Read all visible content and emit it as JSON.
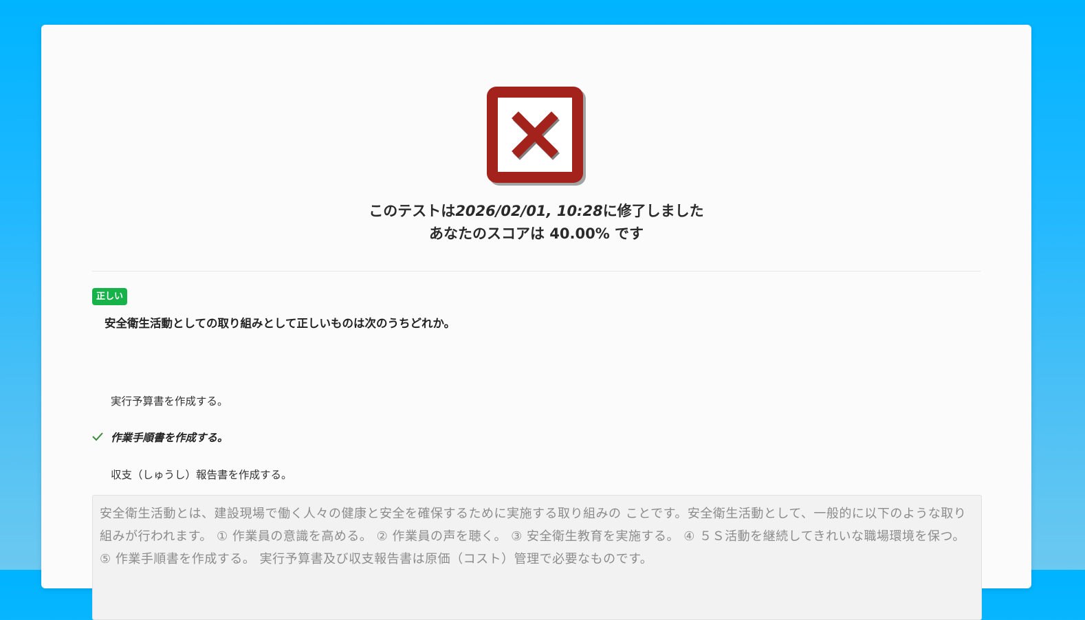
{
  "result": {
    "icon": "red-x-icon",
    "accent_color": "#a3221c",
    "line1_prefix": "このテストは",
    "line1_datetime": "2026/02/01, 10:28",
    "line1_suffix": "に修了しました",
    "line2_prefix": "あなたのスコアは ",
    "score": "40.00%",
    "line2_suffix": " です"
  },
  "question": {
    "badge": "正しい",
    "badge_color": "#18b24b",
    "text": "安全衛生活動としての取り組みとして正しいものは次のうちどれか。",
    "options": [
      {
        "label": "実行予算書を作成する。",
        "selected": false
      },
      {
        "label": "作業手順書を作成する。",
        "selected": true,
        "icon": "check-icon"
      },
      {
        "label": "収支（しゅうし）報告書を作成する。",
        "selected": false
      }
    ],
    "explanation": "安全衛生活動とは、建設現場で働く人々の健康と安全を確保するために実施する取り組みの ことです。安全衛生活動として、一般的に以下のような取り組みが行われます。 ① 作業員の意識を高める。 ② 作業員の声を聴く。 ③ 安全衛生教育を実施する。 ④ ５Ｓ活動を継続してきれいな職場環境を保つ。 ⑤ 作業手順書を作成する。 実行予算書及び収支報告書は原価（コスト）管理で必要なものです。"
  }
}
